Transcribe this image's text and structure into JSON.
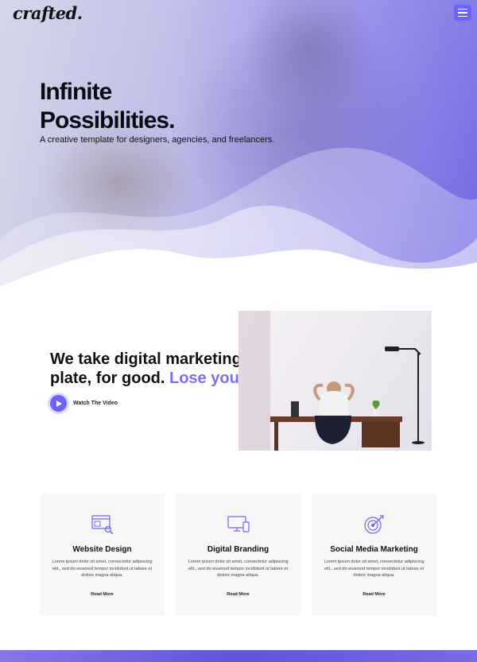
{
  "header": {
    "logo_text": "crafted.",
    "menu_icon": "hamburger-menu-icon",
    "accent_color": "#6c63ff"
  },
  "hero": {
    "title_line1": "Infinite",
    "title_line2": "Possibilities.",
    "subtitle": "A creative template for designers, agencies, and freelancers."
  },
  "marketing": {
    "headline": "We take digital marketing off your plate, for good.",
    "headline_accent": "Lose your limits.",
    "video_label": "Watch The Video",
    "play_icon": "play-icon"
  },
  "services": [
    {
      "icon": "website-design-icon",
      "title": "Website Design",
      "text": "Lorem ipsum dolor sit amet, consectetur adipiscing elit., sed do eiusmod tempor incididunt ut labore et dolore magna aliqua.",
      "link": "Read More"
    },
    {
      "icon": "devices-icon",
      "title": "Digital Branding",
      "text": "Lorem ipsum dolor sit amet, consectetur adipiscing elit., sed do eiusmod tempor incididunt ut labore et dolore magna aliqua.",
      "link": "Read More"
    },
    {
      "icon": "target-icon",
      "title": "Social Media Marketing",
      "text": "Lorem ipsum dolor sit amet, consectetur adipiscing elit., sed do eiusmod tempor incididunt ut labore et dolore magna aliqua.",
      "link": "Read More"
    }
  ]
}
